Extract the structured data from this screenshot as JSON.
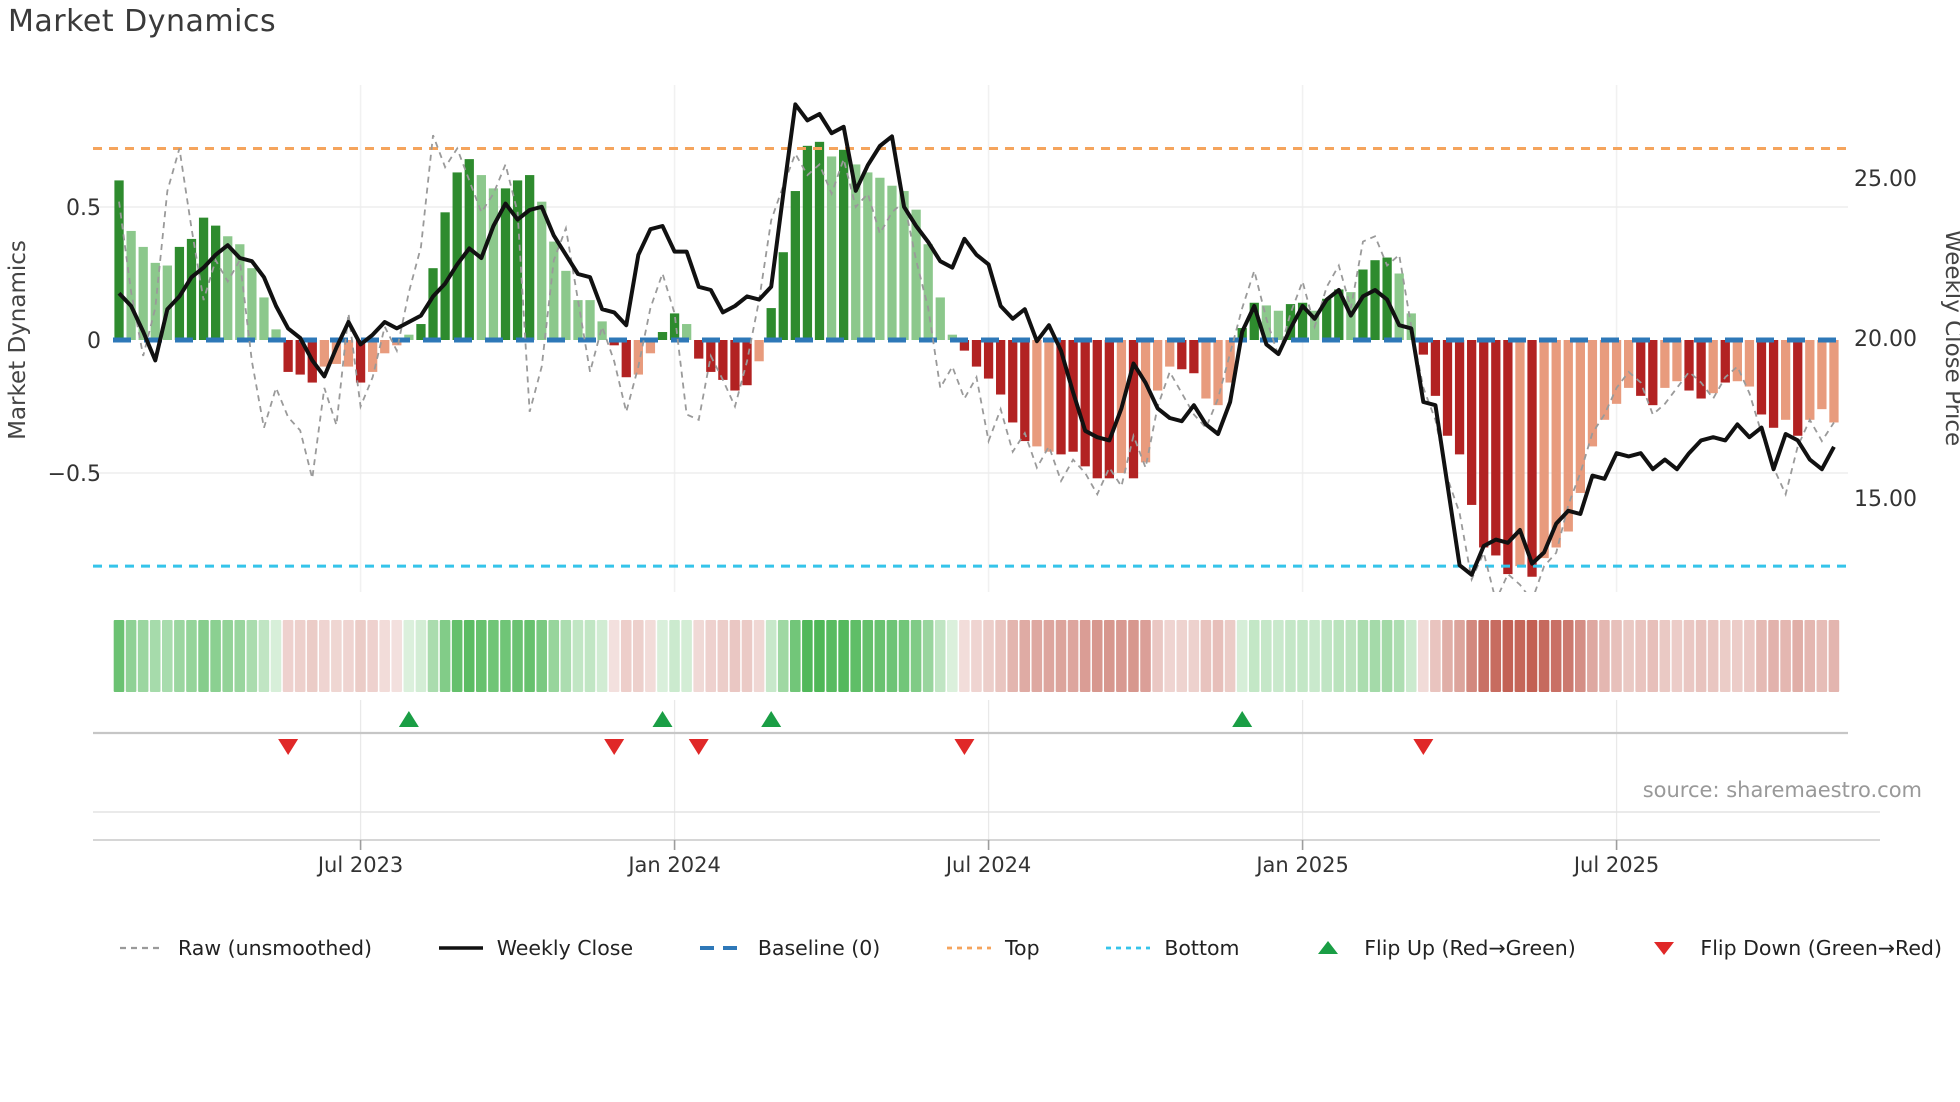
{
  "header": {
    "title": "Market Dynamics"
  },
  "axes": {
    "left_label": "Market Dynamics",
    "right_label": "Weekly Close Price"
  },
  "source_note": "source: sharemaestro.com",
  "legend": {
    "items": [
      {
        "key": "raw",
        "label": "Raw (unsmoothed)"
      },
      {
        "key": "close",
        "label": "Weekly Close"
      },
      {
        "key": "baseline",
        "label": "Baseline (0)"
      },
      {
        "key": "top",
        "label": "Top"
      },
      {
        "key": "bottom",
        "label": "Bottom"
      },
      {
        "key": "flipup",
        "label": "Flip Up (Red→Green)"
      },
      {
        "key": "flipdown",
        "label": "Flip Down (Green→Red)"
      }
    ]
  },
  "chart_data": {
    "type": "bar",
    "subtype": "weekly oscillator bars + raw dashed line (left axis) + weekly close price line (right axis) + heatmap strip + flip markers",
    "title": "Market Dynamics",
    "xlabel": "",
    "ylabel_left": "Market Dynamics",
    "ylabel_right": "Weekly Close Price",
    "n_weeks": 143,
    "x_ticks": [
      {
        "week": 20,
        "label": "Jul 2023"
      },
      {
        "week": 46,
        "label": "Jan 2024"
      },
      {
        "week": 72,
        "label": "Jul 2024"
      },
      {
        "week": 98,
        "label": "Jan 2025"
      },
      {
        "week": 124,
        "label": "Jul 2025"
      }
    ],
    "left_axis": {
      "ticks": [
        {
          "value": 0.5,
          "label": "0.5"
        },
        {
          "value": 0,
          "label": "0"
        },
        {
          "value": -0.5,
          "label": "−0.5"
        }
      ],
      "range": [
        -0.96,
        0.96
      ]
    },
    "right_axis": {
      "ticks": [
        {
          "value": 25,
          "label": "25.00"
        },
        {
          "value": 20,
          "label": "20.00"
        },
        {
          "value": 15,
          "label": "15.00"
        }
      ],
      "range": [
        12.1,
        27.9
      ]
    },
    "bands": {
      "top_value": 0.72,
      "bottom_value": -0.85,
      "baseline_value": 0
    },
    "grid": {
      "h_lines_at": [
        0.5,
        -0.5
      ],
      "v_lines_at_ticks": true
    },
    "legend_position": "bottom",
    "series": [
      {
        "name": "Oscillator (bars)",
        "axis": "left",
        "values": [
          0.6,
          0.41,
          0.35,
          0.29,
          0.28,
          0.35,
          0.38,
          0.46,
          0.43,
          0.39,
          0.36,
          0.27,
          0.16,
          0.04,
          -0.12,
          -0.13,
          -0.16,
          -0.1,
          -0.09,
          -0.1,
          -0.16,
          -0.12,
          -0.05,
          -0.02,
          0.02,
          0.06,
          0.27,
          0.48,
          0.63,
          0.68,
          0.62,
          0.57,
          0.57,
          0.6,
          0.62,
          0.52,
          0.37,
          0.26,
          0.15,
          0.15,
          0.07,
          -0.02,
          -0.14,
          -0.13,
          -0.05,
          0.03,
          0.1,
          0.06,
          -0.07,
          -0.12,
          -0.15,
          -0.19,
          -0.17,
          -0.08,
          0.12,
          0.33,
          0.56,
          0.73,
          0.745,
          0.69,
          0.715,
          0.66,
          0.63,
          0.61,
          0.58,
          0.56,
          0.49,
          0.36,
          0.16,
          0.02,
          -0.04,
          -0.1,
          -0.145,
          -0.205,
          -0.31,
          -0.38,
          -0.4,
          -0.42,
          -0.43,
          -0.42,
          -0.475,
          -0.52,
          -0.52,
          -0.5,
          -0.52,
          -0.46,
          -0.19,
          -0.1,
          -0.11,
          -0.125,
          -0.22,
          -0.245,
          -0.16,
          0.045,
          0.14,
          0.13,
          0.11,
          0.135,
          0.14,
          0.11,
          0.155,
          0.19,
          0.18,
          0.265,
          0.3,
          0.31,
          0.25,
          0.1,
          -0.055,
          -0.21,
          -0.36,
          -0.43,
          -0.62,
          -0.78,
          -0.81,
          -0.88,
          -0.85,
          -0.89,
          -0.82,
          -0.78,
          -0.72,
          -0.575,
          -0.4,
          -0.3,
          -0.24,
          -0.18,
          -0.21,
          -0.245,
          -0.18,
          -0.155,
          -0.19,
          -0.22,
          -0.2,
          -0.16,
          -0.155,
          -0.175,
          -0.28,
          -0.33,
          -0.3,
          -0.36,
          -0.3,
          -0.26,
          -0.31
        ],
        "shade": [
          "d",
          "l",
          "l",
          "l",
          "l",
          "d",
          "d",
          "d",
          "d",
          "l",
          "l",
          "l",
          "l",
          "l",
          "d",
          "d",
          "d",
          "l",
          "l",
          "l",
          "d",
          "l",
          "l",
          "l",
          "l",
          "d",
          "d",
          "d",
          "d",
          "d",
          "l",
          "l",
          "d",
          "d",
          "d",
          "l",
          "l",
          "l",
          "l",
          "l",
          "l",
          "d",
          "d",
          "l",
          "l",
          "d",
          "d",
          "l",
          "d",
          "d",
          "d",
          "d",
          "d",
          "l",
          "d",
          "d",
          "d",
          "d",
          "d",
          "l",
          "d",
          "l",
          "l",
          "l",
          "l",
          "l",
          "l",
          "l",
          "l",
          "l",
          "d",
          "d",
          "d",
          "d",
          "d",
          "d",
          "l",
          "l",
          "d",
          "d",
          "d",
          "d",
          "d",
          "l",
          "d",
          "l",
          "l",
          "l",
          "d",
          "d",
          "l",
          "l",
          "l",
          "d",
          "d",
          "l",
          "l",
          "d",
          "d",
          "l",
          "d",
          "d",
          "l",
          "d",
          "d",
          "d",
          "l",
          "l",
          "d",
          "d",
          "d",
          "d",
          "d",
          "d",
          "d",
          "d",
          "l",
          "d",
          "l",
          "l",
          "l",
          "l",
          "l",
          "l",
          "l",
          "l",
          "d",
          "d",
          "l",
          "l",
          "d",
          "d",
          "l",
          "d",
          "l",
          "l",
          "d",
          "d",
          "l",
          "d",
          "l",
          "l",
          "l"
        ]
      },
      {
        "name": "Raw (unsmoothed)",
        "axis": "left",
        "values": [
          0.52,
          0.18,
          -0.06,
          0.12,
          0.56,
          0.72,
          0.42,
          0.15,
          0.3,
          0.22,
          0.3,
          -0.08,
          -0.33,
          -0.18,
          -0.29,
          -0.34,
          -0.52,
          -0.18,
          -0.32,
          0.1,
          -0.25,
          -0.14,
          0.05,
          -0.04,
          0.18,
          0.35,
          0.77,
          0.65,
          0.72,
          0.6,
          0.48,
          0.55,
          0.66,
          0.48,
          -0.27,
          -0.1,
          0.3,
          0.42,
          0.15,
          -0.12,
          0.05,
          -0.08,
          -0.27,
          -0.1,
          0.12,
          0.25,
          0.1,
          -0.28,
          -0.3,
          -0.06,
          -0.15,
          -0.25,
          -0.08,
          0.15,
          0.45,
          0.58,
          0.7,
          0.62,
          0.66,
          0.55,
          0.68,
          0.5,
          0.55,
          0.4,
          0.48,
          0.52,
          0.3,
          0.12,
          -0.18,
          -0.1,
          -0.22,
          -0.14,
          -0.38,
          -0.26,
          -0.42,
          -0.35,
          -0.48,
          -0.4,
          -0.53,
          -0.45,
          -0.5,
          -0.58,
          -0.48,
          -0.55,
          -0.36,
          -0.48,
          -0.25,
          -0.12,
          -0.2,
          -0.28,
          -0.33,
          -0.22,
          -0.05,
          0.12,
          0.26,
          0.08,
          -0.06,
          0.1,
          0.22,
          0.05,
          0.2,
          0.28,
          0.12,
          0.37,
          0.39,
          0.28,
          0.32,
          0.05,
          -0.18,
          -0.3,
          -0.52,
          -0.65,
          -0.9,
          -0.8,
          -0.98,
          -0.88,
          -0.92,
          -0.98,
          -0.85,
          -0.8,
          -0.62,
          -0.5,
          -0.35,
          -0.28,
          -0.18,
          -0.12,
          -0.16,
          -0.28,
          -0.24,
          -0.18,
          -0.12,
          -0.16,
          -0.22,
          -0.14,
          -0.1,
          -0.2,
          -0.35,
          -0.48,
          -0.58,
          -0.4,
          -0.3,
          -0.38,
          -0.31
        ]
      },
      {
        "name": "Weekly Close",
        "axis": "right",
        "values": [
          21.4,
          21.0,
          20.2,
          19.3,
          20.9,
          21.3,
          21.9,
          22.2,
          22.6,
          22.9,
          22.5,
          22.4,
          21.9,
          21.0,
          20.3,
          20.0,
          19.3,
          18.8,
          19.7,
          20.5,
          19.8,
          20.1,
          20.5,
          20.3,
          20.5,
          20.7,
          21.3,
          21.7,
          22.3,
          22.8,
          22.5,
          23.5,
          24.2,
          23.7,
          24.0,
          24.1,
          23.2,
          22.6,
          22.0,
          21.9,
          20.9,
          20.8,
          20.4,
          22.6,
          23.4,
          23.5,
          22.7,
          22.7,
          21.6,
          21.5,
          20.8,
          21.0,
          21.3,
          21.2,
          21.6,
          24.5,
          27.3,
          26.8,
          27.0,
          26.4,
          26.6,
          24.6,
          25.4,
          26.0,
          26.3,
          24.1,
          23.5,
          23.0,
          22.4,
          22.2,
          23.1,
          22.6,
          22.3,
          21.0,
          20.6,
          20.9,
          19.9,
          20.4,
          19.6,
          18.3,
          17.1,
          16.9,
          16.8,
          17.8,
          19.2,
          18.6,
          17.8,
          17.5,
          17.4,
          17.9,
          17.3,
          17.0,
          18.0,
          20.2,
          21.0,
          19.8,
          19.5,
          20.3,
          21.0,
          20.6,
          21.2,
          21.5,
          20.7,
          21.3,
          21.5,
          21.2,
          20.4,
          20.3,
          18.0,
          17.9,
          15.4,
          12.9,
          12.6,
          13.5,
          13.7,
          13.6,
          14.0,
          12.95,
          13.3,
          14.2,
          14.6,
          14.5,
          15.7,
          15.6,
          16.4,
          16.3,
          16.4,
          15.9,
          16.2,
          15.9,
          16.4,
          16.8,
          16.9,
          16.8,
          17.3,
          16.9,
          17.2,
          15.9,
          17.0,
          16.8,
          16.2,
          15.9,
          16.6
        ]
      }
    ],
    "markers": {
      "flip_up_weeks": [
        24,
        45,
        54,
        93
      ],
      "flip_down_weeks": [
        14,
        41,
        48,
        70,
        108
      ]
    },
    "heatmap": {
      "note": "pastel strip, one cell per week, color intensity follows oscillator value sign/magnitude"
    },
    "colors": {
      "bar_green_dark": "#2e8b2e",
      "bar_green_light": "#8cc88c",
      "bar_red_dark": "#b22222",
      "bar_red_light": "#e89b7d",
      "weekly_close": "#111111",
      "raw": "#9a9a9a",
      "baseline": "#2e78b8",
      "top": "#f5a45c",
      "bottom": "#35c4ea",
      "flip_up": "#1a9e45",
      "flip_down": "#e02828",
      "grid": "#ededed",
      "axis_line": "#c9c9c9",
      "tick_text": "#333333",
      "muted_text": "#919191"
    }
  }
}
